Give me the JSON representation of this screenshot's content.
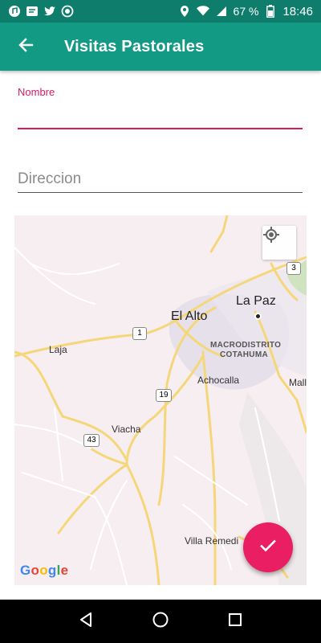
{
  "status_bar": {
    "battery": "67 %",
    "time": "18:46",
    "icons": [
      "music-icon",
      "message-icon",
      "twitter-icon",
      "record-icon",
      "location-icon",
      "wifi-icon",
      "signal-icon",
      "battery-icon"
    ]
  },
  "app_bar": {
    "title": "Visitas Pastorales",
    "back_icon": "arrow-left-icon",
    "color": "#139a84"
  },
  "form": {
    "nombre": {
      "label": "Nombre",
      "value": ""
    },
    "direccion": {
      "placeholder": "Direccion",
      "value": ""
    },
    "accent_color": "#d81b60"
  },
  "map": {
    "labels": {
      "la_paz": "La Paz",
      "el_alto": "El Alto",
      "macrodistrito": "MACRODISTRITO",
      "cotahuma": "COTAHUMA",
      "achocalla": "Achocalla",
      "mall": "Mall",
      "laja": "Laja",
      "viacha": "Viacha",
      "villa_remedios": "Villa Remedi"
    },
    "route_shields": {
      "r3": "3",
      "r1": "1",
      "r19": "19",
      "r43": "43"
    },
    "attribution": "Google",
    "my_location_icon": "crosshair-icon"
  },
  "fab": {
    "icon": "check-icon",
    "color": "#e91e63"
  },
  "nav_bar": {
    "icons": [
      "back-triangle-icon",
      "home-circle-icon",
      "recents-square-icon"
    ]
  }
}
